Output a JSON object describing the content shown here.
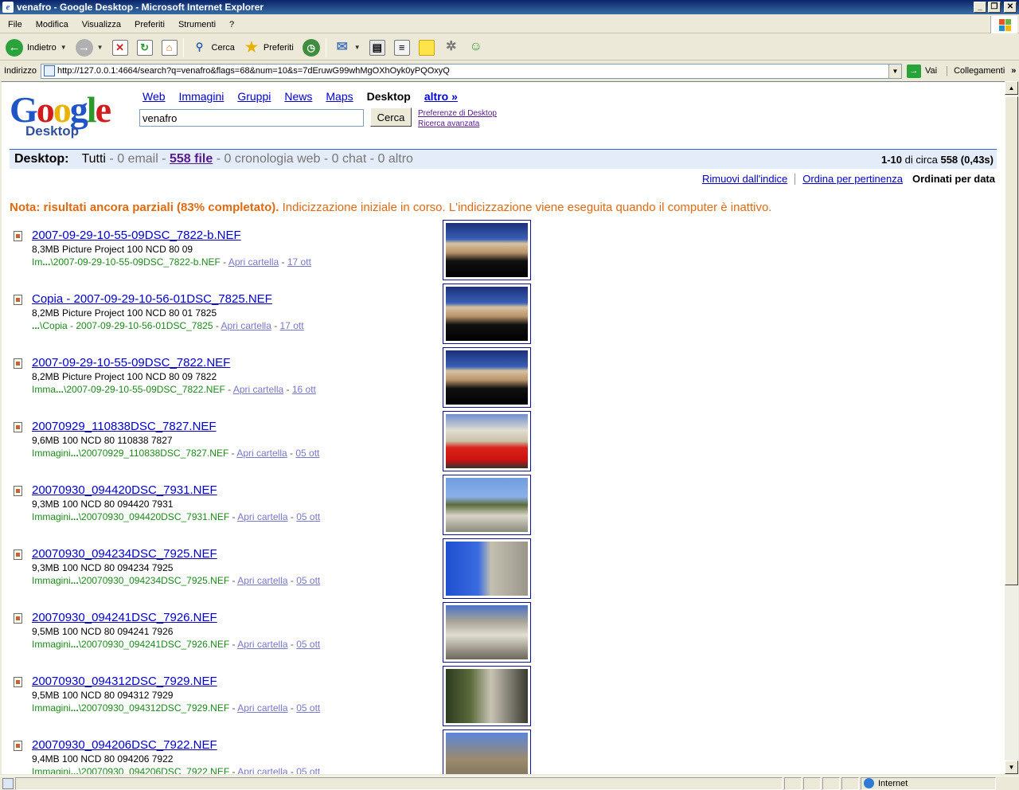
{
  "window": {
    "title": "venafro - Google Desktop - Microsoft Internet Explorer",
    "caption_buttons": [
      "_",
      "❐",
      "✕"
    ]
  },
  "menu": [
    "File",
    "Modifica",
    "Visualizza",
    "Preferiti",
    "Strumenti",
    "?"
  ],
  "toolbar": {
    "back_label": "Indietro",
    "search_label": "Cerca",
    "favorites_label": "Preferiti"
  },
  "address": {
    "label": "Indirizzo",
    "url": "http://127.0.0.1:4664/search?q=venafro&flags=68&num=10&s=7dEruwG99whMgOXhOyk0yPQOxyQ",
    "go_label": "Vai",
    "links_label": "Collegamenti",
    "links_more": "»"
  },
  "gd": {
    "logo_text": "Google",
    "logo_sub": "Desktop",
    "tabs": [
      "Web",
      "Immagini",
      "Gruppi",
      "News",
      "Maps"
    ],
    "current_tab": "Desktop",
    "more_tab": "altro »",
    "query": "venafro",
    "search_button": "Cerca",
    "pref_link": "Preferenze di Desktop",
    "adv_link": "Ricerca avanzata"
  },
  "categories": {
    "label": "Desktop:",
    "all": "Tutti",
    "email": "0 email",
    "files": "558 file",
    "history": "0 cronologia web",
    "chat": "0 chat",
    "other": "0 altro",
    "range": "1-10",
    "count_mid": "di circa",
    "total": "558",
    "time": "(0,43s)"
  },
  "sort": {
    "remove": "Rimuovi dall'indice",
    "relevance": "Ordina per pertinenza",
    "date": "Ordinati per data"
  },
  "notice": {
    "bold": "Nota: risultati ancora parziali (83% completato).",
    "rest": "Indicizzazione iniziale in corso. L'indicizzazione viene eseguita quando il computer è inattivo."
  },
  "open_folder": "Apri cartella",
  "results": [
    {
      "title": "2007-09-29-10-55-09DSC_7822-b.NEF",
      "meta": "8,3MB Picture Project 100 NCD 80 09",
      "path_pre": "Im",
      "path": "\\2007-09-29-10-55-09DSC_7822-b.NEF",
      "date": "17 ott"
    },
    {
      "title": "Copia - 2007-09-29-10-56-01DSC_7825.NEF",
      "meta": "8,2MB Picture Project 100 NCD 80 01 7825",
      "path_pre": "",
      "path": "\\Copia - 2007-09-29-10-56-01DSC_7825",
      "date": "17 ott"
    },
    {
      "title": "2007-09-29-10-55-09DSC_7822.NEF",
      "meta": "8,2MB Picture Project 100 NCD 80 09 7822",
      "path_pre": "Imma",
      "path": "\\2007-09-29-10-55-09DSC_7822.NEF",
      "date": "16 ott"
    },
    {
      "title": "20070929_110838DSC_7827.NEF",
      "meta": "9,6MB 100 NCD 80 110838 7827",
      "path_pre": "Immagini",
      "path": "\\20070929_110838DSC_7827.NEF",
      "date": "05 ott"
    },
    {
      "title": "20070930_094420DSC_7931.NEF",
      "meta": "9,3MB 100 NCD 80 094420 7931",
      "path_pre": "Immagini",
      "path": "\\20070930_094420DSC_7931.NEF",
      "date": "05 ott"
    },
    {
      "title": "20070930_094234DSC_7925.NEF",
      "meta": "9,3MB 100 NCD 80 094234 7925",
      "path_pre": "Immagini",
      "path": "\\20070930_094234DSC_7925.NEF",
      "date": "05 ott"
    },
    {
      "title": "20070930_094241DSC_7926.NEF",
      "meta": "9,5MB 100 NCD 80 094241 7926",
      "path_pre": "Immagini",
      "path": "\\20070930_094241DSC_7926.NEF",
      "date": "05 ott"
    },
    {
      "title": "20070930_094312DSC_7929.NEF",
      "meta": "9,5MB 100 NCD 80 094312 7929",
      "path_pre": "Immagini",
      "path": "\\20070930_094312DSC_7929.NEF",
      "date": "05 ott"
    },
    {
      "title": "20070930_094206DSC_7922.NEF",
      "meta": "9,4MB 100 NCD 80 094206 7922",
      "path_pre": "Immagini",
      "path": "\\20070930_094206DSC_7922.NEF",
      "date": "05 ott"
    }
  ],
  "status": {
    "zone": "Internet"
  }
}
